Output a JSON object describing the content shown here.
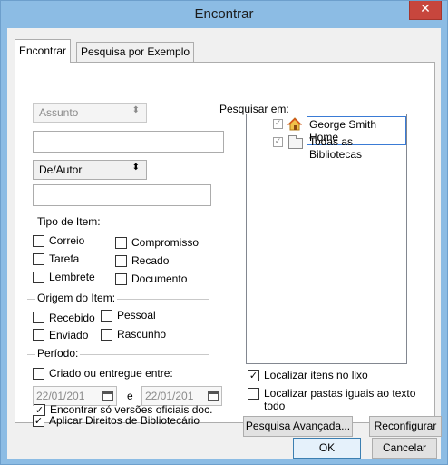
{
  "window": {
    "title": "Encontrar",
    "close_glyph": "✕"
  },
  "tabs": [
    {
      "label": "Encontrar",
      "active": true
    },
    {
      "label": "Pesquisa por Exemplo",
      "active": false
    }
  ],
  "left": {
    "subject_combo": {
      "value": "Assunto",
      "enabled": false
    },
    "subject_input": {
      "value": ""
    },
    "author_combo": {
      "value": "De/Autor",
      "enabled": true
    },
    "author_input": {
      "value": ""
    },
    "item_type": {
      "title": "Tipo de Item:",
      "options": [
        {
          "label": "Correio",
          "checked": false
        },
        {
          "label": "Compromisso",
          "checked": false
        },
        {
          "label": "Tarefa",
          "checked": false
        },
        {
          "label": "Recado",
          "checked": false
        },
        {
          "label": "Lembrete",
          "checked": false
        },
        {
          "label": "Documento",
          "checked": false
        }
      ]
    },
    "item_origin": {
      "title": "Origem do Item:",
      "options": [
        {
          "label": "Recebido",
          "checked": false
        },
        {
          "label": "Pessoal",
          "checked": false
        },
        {
          "label": "Enviado",
          "checked": false
        },
        {
          "label": "Rascunho",
          "checked": false
        }
      ]
    },
    "period": {
      "title": "Período:",
      "created_label": "Criado ou entregue entre:",
      "created_checked": false,
      "date_from": "22/01/201",
      "and_label": "e",
      "date_to": "22/01/201"
    },
    "apply_rights": {
      "label": "Aplicar Direitos de Bibliotecário",
      "checked": true
    },
    "official_only": {
      "label": "Encontrar só versões oficiais doc.",
      "checked": true
    }
  },
  "right": {
    "search_in_label": "Pesquisar em:",
    "tree": [
      {
        "label": "George Smith Home",
        "icon": "home-icon",
        "checked": true,
        "selected": true
      },
      {
        "label": "Todas as Bibliotecas",
        "icon": "folder-icon",
        "checked": true,
        "selected": false
      }
    ],
    "trash": {
      "label": "Localizar itens no lixo",
      "checked": true
    },
    "folders": {
      "label": "Localizar pastas iguais ao texto todo",
      "checked": false
    },
    "advanced_button": "Pesquisa Avançada...",
    "reset_button": "Reconfigurar"
  },
  "footer": {
    "ok": "OK",
    "cancel": "Cancelar"
  },
  "colors": {
    "titlebar": "#8cbce4",
    "close": "#c7463d",
    "selection_border": "#3a7bd5",
    "home_roof": "#d9541e"
  }
}
